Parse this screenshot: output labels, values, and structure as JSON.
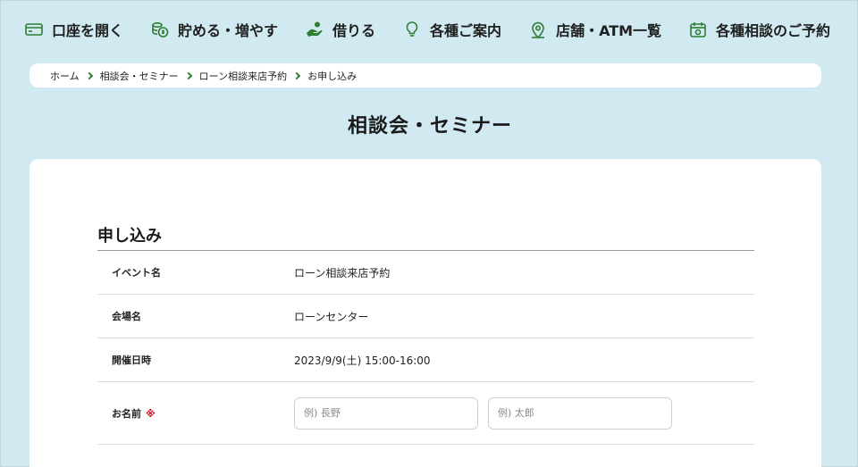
{
  "nav": {
    "items": [
      {
        "label": "口座を開く",
        "icon": "card-icon"
      },
      {
        "label": "貯める・増やす",
        "icon": "coins-icon"
      },
      {
        "label": "借りる",
        "icon": "hand-coin-icon"
      },
      {
        "label": "各種ご案内",
        "icon": "lightbulb-icon"
      },
      {
        "label": "店舗・ATM一覧",
        "icon": "map-pin-icon"
      },
      {
        "label": "各種相談のご予約",
        "icon": "calendar-icon"
      }
    ]
  },
  "breadcrumb": {
    "items": [
      "ホーム",
      "相談会・セミナー",
      "ローン相談来店予約",
      "お申し込み"
    ]
  },
  "page": {
    "title": "相談会・セミナー"
  },
  "form": {
    "section_title": "申し込み",
    "rows": [
      {
        "label": "イベント名",
        "value": "ローン相談来店予約"
      },
      {
        "label": "会場名",
        "value": "ローンセンター"
      },
      {
        "label": "開催日時",
        "value": "2023/9/9(土) 15:00-16:00"
      }
    ],
    "name_row": {
      "label": "お名前",
      "required_mark": "※",
      "last_name_placeholder": "例) 長野",
      "first_name_placeholder": "例) 太郎"
    }
  },
  "colors": {
    "background": "#d1e9f0",
    "accent_green": "#2e7d32",
    "required_red": "#d0021b"
  }
}
